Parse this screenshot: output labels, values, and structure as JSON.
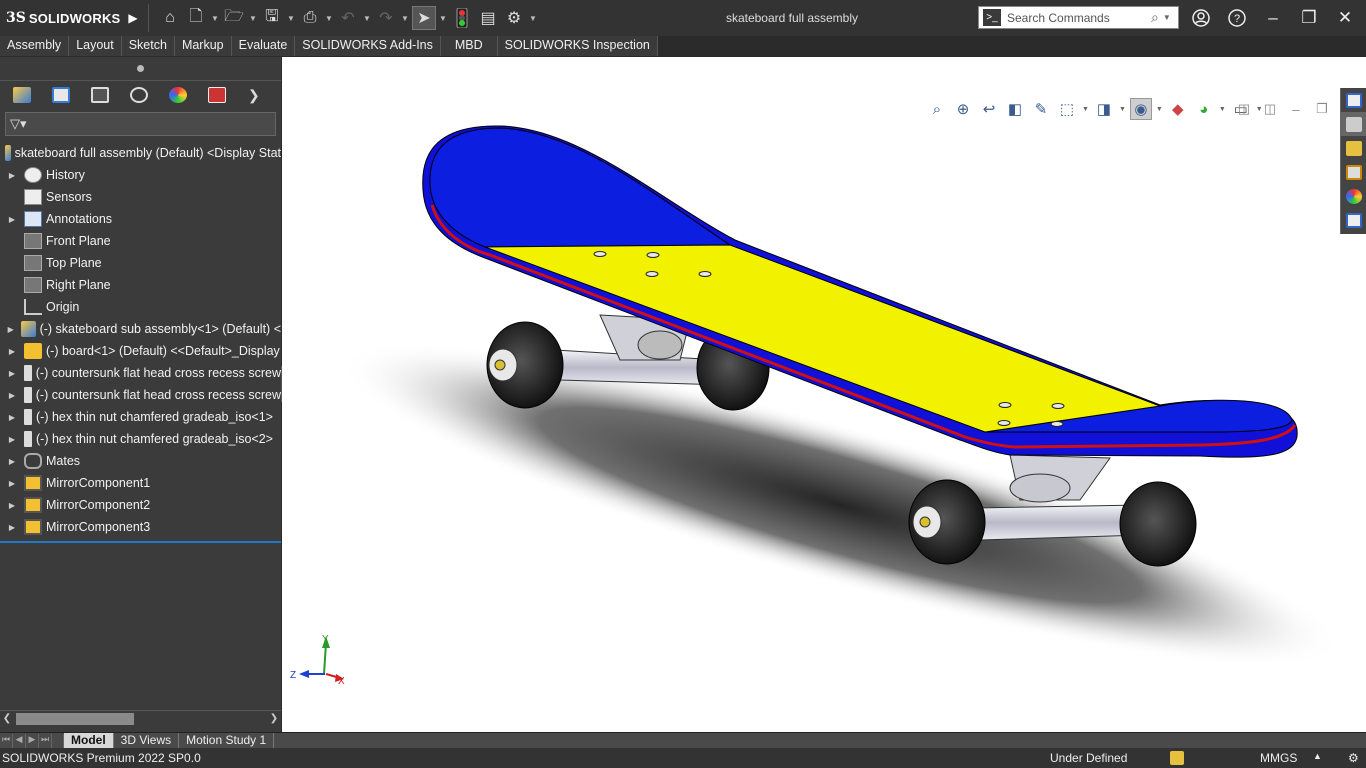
{
  "app": {
    "logo_ds": "3S",
    "logo_text": "SOLIDWORKS",
    "document_title": "skateboard full assembly",
    "search_placeholder": "Search Commands"
  },
  "command_tabs": [
    "Assembly",
    "Layout",
    "Sketch",
    "Markup",
    "Evaluate",
    "SOLIDWORKS Add-Ins",
    "MBD",
    "SOLIDWORKS Inspection"
  ],
  "tree": {
    "root": "skateboard full assembly (Default) <Display Stat",
    "items": [
      {
        "label": "History",
        "icon": "history-icon",
        "expandable": true
      },
      {
        "label": "Sensors",
        "icon": "sensors-icon",
        "expandable": false
      },
      {
        "label": "Annotations",
        "icon": "annotations-icon",
        "expandable": true
      },
      {
        "label": "Front Plane",
        "icon": "plane-icon",
        "expandable": false
      },
      {
        "label": "Top Plane",
        "icon": "plane-icon",
        "expandable": false
      },
      {
        "label": "Right Plane",
        "icon": "plane-icon",
        "expandable": false
      },
      {
        "label": "Origin",
        "icon": "origin-icon",
        "expandable": false
      },
      {
        "label": "(-) skateboard sub assembly<1> (Default) <",
        "icon": "subassembly-icon",
        "expandable": true
      },
      {
        "label": "(-) board<1> (Default) <<Default>_Display",
        "icon": "part-icon",
        "expandable": true
      },
      {
        "label": "(-) countersunk flat head cross recess screw",
        "icon": "screw-icon",
        "expandable": true
      },
      {
        "label": "(-) countersunk flat head cross recess screw",
        "icon": "screw-icon",
        "expandable": true
      },
      {
        "label": "(-) hex thin nut chamfered gradeab_iso<1>",
        "icon": "screw-icon",
        "expandable": true
      },
      {
        "label": "(-) hex thin nut chamfered gradeab_iso<2>",
        "icon": "screw-icon",
        "expandable": true
      },
      {
        "label": "Mates",
        "icon": "mates-icon",
        "expandable": true
      },
      {
        "label": "MirrorComponent1",
        "icon": "mirror-icon",
        "expandable": true
      },
      {
        "label": "MirrorComponent2",
        "icon": "mirror-icon",
        "expandable": true
      },
      {
        "label": "MirrorComponent3",
        "icon": "mirror-icon",
        "expandable": true
      }
    ]
  },
  "bottom_tabs": [
    "Model",
    "3D Views",
    "Motion Study 1"
  ],
  "status": {
    "product": "SOLIDWORKS Premium 2022 SP0.0",
    "definition": "Under Defined",
    "units": "MMGS"
  },
  "triad": {
    "y": "Y",
    "z": "Z",
    "x": "X"
  },
  "colors": {
    "deck_top": "#f2f200",
    "deck_side": "#1010d8",
    "deck_stripe": "#d01010",
    "tree_selection": "#1e78c8"
  }
}
